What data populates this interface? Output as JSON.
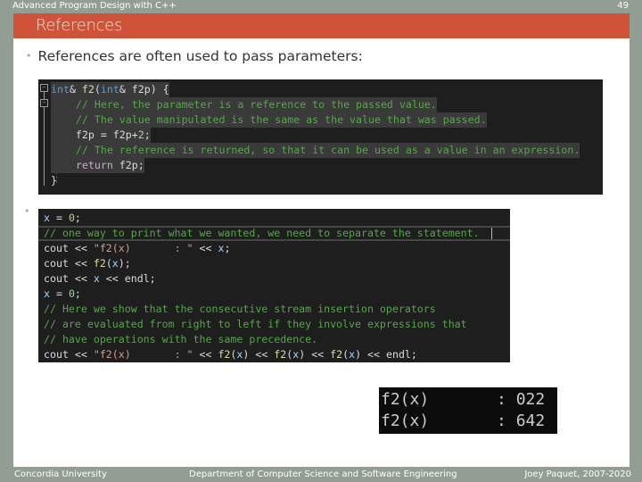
{
  "header": {
    "course": "Advanced Program Design with C++",
    "page_number": "49"
  },
  "slide": {
    "title": "References",
    "bullets": [
      "References are often used to pass parameters:",
      ""
    ],
    "bullet_glyph": "•"
  },
  "code_block_1": {
    "lines": [
      {
        "segments": [
          {
            "t": "int",
            "c": "kw"
          },
          {
            "t": "& ",
            "c": ""
          },
          {
            "t": "f2",
            "c": "fn"
          },
          {
            "t": "(",
            "c": ""
          },
          {
            "t": "int",
            "c": "kw"
          },
          {
            "t": "& f2p) {",
            "c": ""
          }
        ]
      },
      {
        "segments": [
          {
            "t": "    ",
            "c": ""
          },
          {
            "t": "// Here, the parameter is a reference to the passed value.",
            "c": "cm"
          }
        ]
      },
      {
        "segments": [
          {
            "t": "    ",
            "c": ""
          },
          {
            "t": "// The value manipulated is the same as the value that was passed.",
            "c": "cm"
          }
        ]
      },
      {
        "segments": [
          {
            "t": "    f2p = f2p+",
            "c": ""
          },
          {
            "t": "2",
            "c": "num"
          },
          {
            "t": ";",
            "c": ""
          }
        ]
      },
      {
        "segments": [
          {
            "t": "    ",
            "c": ""
          },
          {
            "t": "// The reference is returned, so that it can be used as a value in an expression.",
            "c": "cm"
          }
        ]
      },
      {
        "segments": [
          {
            "t": "    ",
            "c": ""
          },
          {
            "t": "return",
            "c": "kwp"
          },
          {
            "t": " f2p;",
            "c": ""
          }
        ]
      },
      {
        "segments": [
          {
            "t": "}",
            "c": ""
          }
        ]
      }
    ]
  },
  "code_block_2": {
    "lines": [
      {
        "segments": [
          {
            "t": "x",
            "c": "var"
          },
          {
            "t": " = ",
            "c": ""
          },
          {
            "t": "0",
            "c": "num"
          },
          {
            "t": ";",
            "c": ""
          }
        ]
      },
      {
        "segments": [
          {
            "t": "// one way to print what we wanted, we need to separate the statement.",
            "c": "cm"
          }
        ]
      },
      {
        "segments": [
          {
            "t": "cout << ",
            "c": ""
          },
          {
            "t": "\"f2(x)       : \"",
            "c": "str"
          },
          {
            "t": " << ",
            "c": ""
          },
          {
            "t": "x",
            "c": "var"
          },
          {
            "t": ";",
            "c": ""
          }
        ]
      },
      {
        "segments": [
          {
            "t": "cout << ",
            "c": ""
          },
          {
            "t": "f2",
            "c": "fn"
          },
          {
            "t": "(",
            "c": ""
          },
          {
            "t": "x",
            "c": "var"
          },
          {
            "t": ");",
            "c": ""
          }
        ]
      },
      {
        "segments": [
          {
            "t": "cout << ",
            "c": ""
          },
          {
            "t": "x",
            "c": "var"
          },
          {
            "t": " << endl;",
            "c": ""
          }
        ]
      },
      {
        "segments": [
          {
            "t": "x",
            "c": "var"
          },
          {
            "t": " = ",
            "c": ""
          },
          {
            "t": "0",
            "c": "num"
          },
          {
            "t": ";",
            "c": ""
          }
        ]
      },
      {
        "segments": [
          {
            "t": "// Here we show that the consecutive stream insertion operators",
            "c": "cm"
          }
        ]
      },
      {
        "segments": [
          {
            "t": "// are evaluated from right to left if they involve expressions that",
            "c": "cm"
          }
        ]
      },
      {
        "segments": [
          {
            "t": "// have operations with the same precedence.",
            "c": "cm"
          }
        ]
      },
      {
        "segments": [
          {
            "t": "cout << ",
            "c": ""
          },
          {
            "t": "\"f2(x)       : \"",
            "c": "str"
          },
          {
            "t": " << ",
            "c": ""
          },
          {
            "t": "f2",
            "c": "fn"
          },
          {
            "t": "(",
            "c": ""
          },
          {
            "t": "x",
            "c": "var"
          },
          {
            "t": ") << ",
            "c": ""
          },
          {
            "t": "f2",
            "c": "fn"
          },
          {
            "t": "(",
            "c": ""
          },
          {
            "t": "x",
            "c": "var"
          },
          {
            "t": ") << ",
            "c": ""
          },
          {
            "t": "f2",
            "c": "fn"
          },
          {
            "t": "(",
            "c": ""
          },
          {
            "t": "x",
            "c": "var"
          },
          {
            "t": ") << endl;",
            "c": ""
          }
        ]
      }
    ]
  },
  "console_output": {
    "lines": [
      "f2(x)       : 022",
      "f2(x)       : 642"
    ]
  },
  "footer": {
    "left": "Concordia University",
    "center": "Department of Computer Science and Software Engineering",
    "right": "Joey Paquet, 2007-2020"
  },
  "colors": {
    "title_bar": "#cf5339",
    "frame": "#929e94",
    "code_bg": "#1e1e1e",
    "comment": "#57a64a",
    "keyword": "#569cd6"
  }
}
